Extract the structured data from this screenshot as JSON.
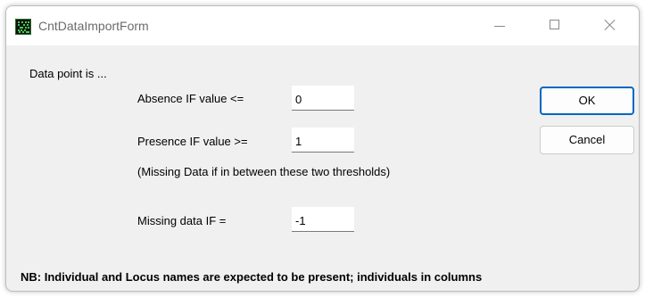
{
  "window": {
    "title": "CntDataImportForm",
    "app_icon": "green-dot-matrix-icon",
    "controls": [
      "minimize-icon",
      "maximize-icon",
      "close-icon"
    ]
  },
  "form": {
    "heading": "Data point is ...",
    "absence_label": "Absence IF value <=",
    "absence_value": "0",
    "presence_label": "Presence IF value >=",
    "presence_value": "1",
    "missing_hint": "(Missing Data if in between these two thresholds)",
    "missing_label": "Missing data IF =",
    "missing_value": "-1",
    "note": "NB: Individual and Locus names are expected to be present; individuals in columns"
  },
  "buttons": {
    "ok_label": "OK",
    "cancel_label": "Cancel"
  },
  "colors": {
    "accent": "#0067c0",
    "dialog_bg": "#f0f0f0",
    "icon_green": "#3fd24a"
  }
}
